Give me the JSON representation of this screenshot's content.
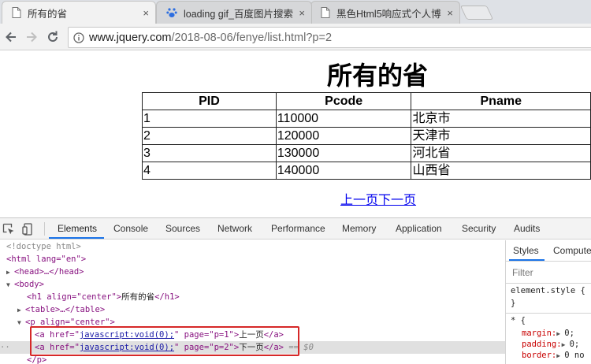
{
  "browser": {
    "tabs": [
      {
        "title": "所有的省",
        "close": "×",
        "active": true
      },
      {
        "title": "loading gif_百度图片搜索",
        "close": "×",
        "active": false
      },
      {
        "title": "黑色Html5响应式个人博",
        "close": "×",
        "active": false
      }
    ],
    "url_host": "www.jquery.com",
    "url_path": "/2018-08-06/fenye/list.html?p=2"
  },
  "page": {
    "title": "所有的省",
    "table": {
      "headers": [
        "PID",
        "Pcode",
        "Pname"
      ],
      "rows": [
        [
          "1",
          "110000",
          "北京市"
        ],
        [
          "2",
          "120000",
          "天津市"
        ],
        [
          "3",
          "130000",
          "河北省"
        ],
        [
          "4",
          "140000",
          "山西省"
        ]
      ]
    },
    "pager": {
      "prev": "上一页",
      "next": "下一页"
    }
  },
  "devtools": {
    "tabs": [
      "Elements",
      "Console",
      "Sources",
      "Network",
      "Performance",
      "Memory",
      "Application",
      "Security",
      "Audits"
    ],
    "active_tab": "Elements",
    "dom": {
      "doctype": "<!doctype html>",
      "html_open": "<html lang=\"en\">",
      "head": "<head>…</head>",
      "body_open": "<body>",
      "h1_open": "<h1 align=\"center\">",
      "h1_text": "所有的省",
      "h1_close": "</h1>",
      "table": "<table>…</table>",
      "p_open": "<p align=\"center\">",
      "a_open_prefix": "<a href=\"",
      "a_href": "javascript:void(0);",
      "a1_mid": "\" page=\"p=1\">",
      "a1_text": "上一页",
      "a2_mid": "\" page=\"p=2\">",
      "a2_text": "下一页",
      "a_close": "</a>",
      "selected_marker": "== $0",
      "p_close": "</p>"
    },
    "styles": {
      "tabs": [
        "Styles",
        "Computed"
      ],
      "filter_placeholder": "Filter",
      "element_style": "element.style {",
      "brace_close": "}",
      "rule_open": "* {",
      "margin": "margin:",
      "margin_val": "0;",
      "padding": "padding:",
      "padding_val": "0;",
      "border": "border:",
      "border_val": "0 no"
    }
  },
  "colors": {
    "tag": "#881280",
    "attr": "#994500",
    "value": "#1a1aa6",
    "highlight": "#d62828",
    "accent": "#1a73e8"
  }
}
